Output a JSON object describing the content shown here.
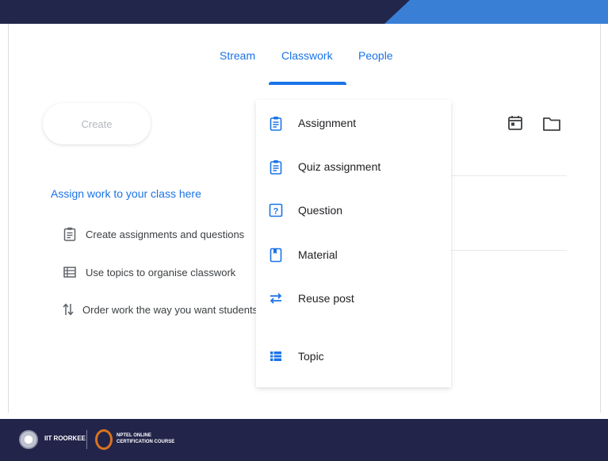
{
  "tabs": {
    "stream": "Stream",
    "classwork": "Classwork",
    "people": "People"
  },
  "create_button": "Create",
  "assign_section": {
    "heading": "Assign work to your class here",
    "hints": [
      {
        "icon": "assignment-icon",
        "text": "Create assignments and questions"
      },
      {
        "icon": "topic-icon",
        "text": "Use topics to organise classwork"
      },
      {
        "icon": "reorder-icon",
        "text": "Order work the way you want students to see it"
      }
    ]
  },
  "create_menu": {
    "items": [
      {
        "icon": "assignment-icon",
        "label": "Assignment"
      },
      {
        "icon": "quiz-assignment-icon",
        "label": "Quiz assignment"
      },
      {
        "icon": "question-icon",
        "label": "Question"
      },
      {
        "icon": "material-icon",
        "label": "Material"
      },
      {
        "icon": "reuse-icon",
        "label": "Reuse post"
      },
      {
        "icon": "topic-icon",
        "label": "Topic"
      }
    ]
  },
  "toolbar_icons": [
    "calendar-icon",
    "folder-icon"
  ],
  "footer": {
    "org": "IIT ROORKEE",
    "course_line1": "NPTEL ONLINE",
    "course_line2": "CERTIFICATION COURSE"
  },
  "colors": {
    "accent": "#1a73e8",
    "band": "#22264a",
    "band_accent": "#3a7fd6"
  }
}
